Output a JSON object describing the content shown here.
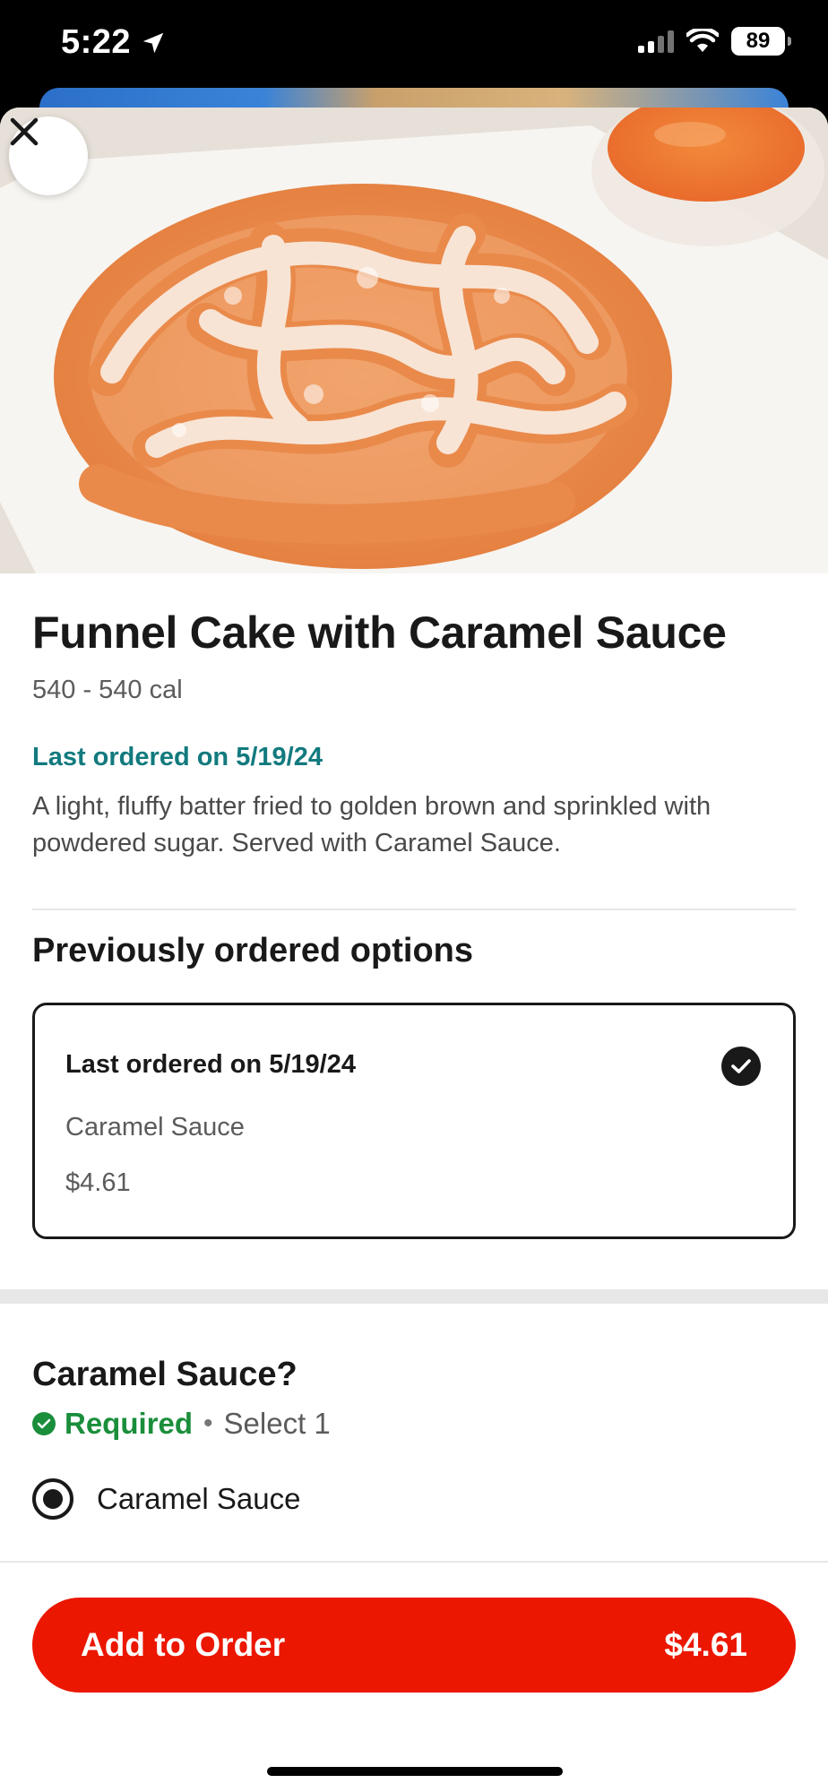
{
  "status_bar": {
    "time": "5:22",
    "battery": "89"
  },
  "item": {
    "title": "Funnel Cake with Caramel Sauce",
    "calories": "540 - 540 cal",
    "last_ordered": "Last ordered on 5/19/24",
    "description": "A light, fluffy batter fried to golden brown and sprinkled with powdered sugar. Served with Caramel Sauce."
  },
  "previous_options": {
    "section_title": "Previously ordered options",
    "card": {
      "title": "Last ordered on 5/19/24",
      "option": "Caramel Sauce",
      "price": "$4.61",
      "selected": true
    }
  },
  "question": {
    "title": "Caramel Sauce?",
    "required_label": "Required",
    "separator": "•",
    "select_hint": "Select 1",
    "options": [
      {
        "label": "Caramel Sauce",
        "selected": true
      }
    ]
  },
  "footer": {
    "button_label": "Add to Order",
    "button_price": "$4.61"
  },
  "colors": {
    "accent_red": "#eb1700",
    "teal": "#127a7e",
    "required_green": "#1a8e3b"
  },
  "icons": {
    "close": "close-icon",
    "location": "location-arrow-icon",
    "check": "checkmark-icon"
  }
}
